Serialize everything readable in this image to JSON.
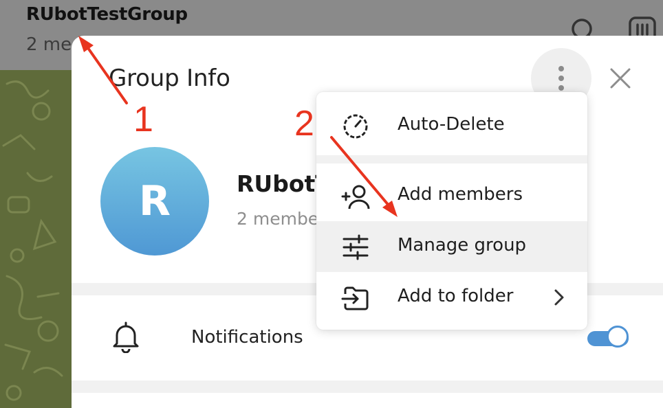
{
  "chat_header": {
    "title": "RUbotTestGroup",
    "subtitle": "2 me",
    "icons": [
      "search-icon",
      "columns-icon"
    ]
  },
  "dialog": {
    "title": "Group Info",
    "more_icon": "vertical-dots-icon",
    "close_icon": "close-icon",
    "avatar_letter": "R",
    "group_name": "RUbotT",
    "group_members": "2 membe",
    "notifications": {
      "label": "Notifications",
      "icon": "bell-icon",
      "enabled": true
    }
  },
  "menu": {
    "items": [
      {
        "label": "Auto-Delete",
        "icon": "timer-icon"
      },
      {
        "label": "Add members",
        "icon": "add-user-icon"
      },
      {
        "label": "Manage group",
        "icon": "sliders-icon",
        "highlighted": true
      },
      {
        "label": "Add to folder",
        "icon": "folder-move-icon",
        "has_submenu": true
      }
    ]
  },
  "annotations": {
    "step_1": "1",
    "step_2": "2",
    "color": "#e8341f"
  },
  "colors": {
    "accent": "#4f93d4",
    "avatar_top": "#77c5e2",
    "avatar_bottom": "#4f98d4",
    "annotation": "#e8341f"
  }
}
